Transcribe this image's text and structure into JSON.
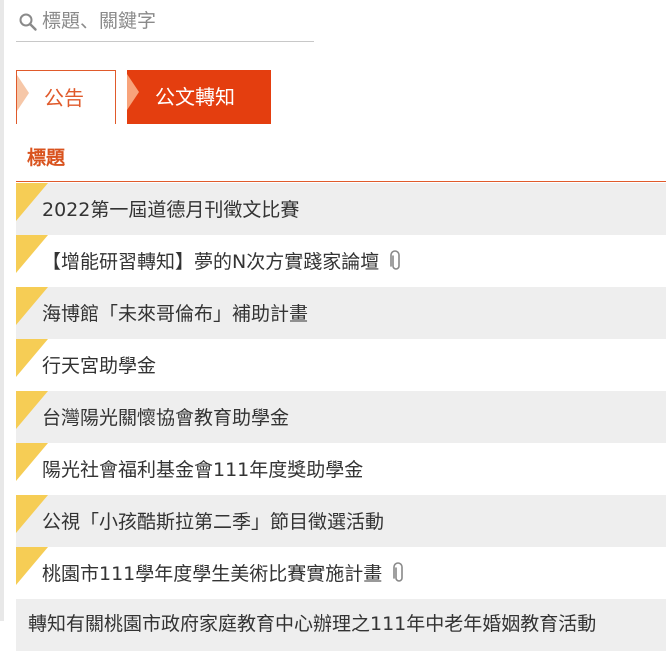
{
  "search": {
    "placeholder": "標題、關鍵字",
    "value": ""
  },
  "tabs": [
    {
      "label": "公告",
      "active": false
    },
    {
      "label": "公文轉知",
      "active": true
    }
  ],
  "table": {
    "column_header": "標題"
  },
  "items": [
    {
      "title": "2022第一屆道德月刊徵文比賽",
      "has_attachment": false
    },
    {
      "title": "【增能研習轉知】夢的N次方實踐家論壇",
      "has_attachment": true
    },
    {
      "title": "海博館「未來哥倫布」補助計畫",
      "has_attachment": false
    },
    {
      "title": "行天宮助學金",
      "has_attachment": false
    },
    {
      "title": "台灣陽光關懷協會教育助學金",
      "has_attachment": false
    },
    {
      "title": "陽光社會福利基金會111年度獎助學金",
      "has_attachment": false
    },
    {
      "title": "公視「小孩酷斯拉第二季」節目徵選活動",
      "has_attachment": false
    },
    {
      "title": "桃園市111學年度學生美術比賽實施計畫",
      "has_attachment": true
    },
    {
      "title": "轉知有關桃園市政府家庭教育中心辦理之111年中老年婚姻教育活動",
      "has_attachment": false
    }
  ],
  "colors": {
    "accent": "#e43e0f",
    "accent_text": "#d9531e",
    "corner_flag": "#f6cd55",
    "row_alt": "#eeeeee"
  },
  "icons": {
    "search": "search-icon",
    "attachment": "paperclip-icon"
  }
}
